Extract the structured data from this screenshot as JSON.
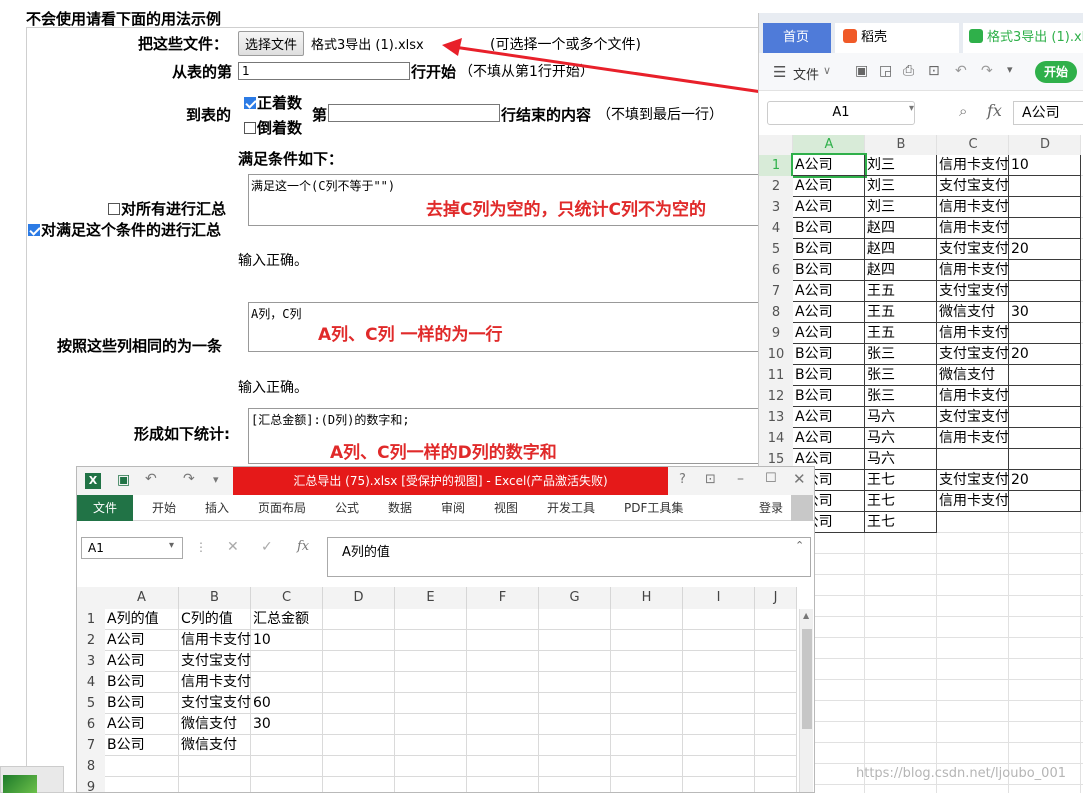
{
  "page": {
    "heading": "不会使用请看下面的用法示例",
    "file_label": "把这些文件：",
    "file_button": "选择文件",
    "file_name": "格式3导出 (1).xlsx",
    "file_hint": "(可选择一个或多个文件)",
    "from_row_label": "从表的第",
    "from_row_value": "1",
    "from_row_suffix": "行开始",
    "from_row_hint": "（不填从第1行开始）",
    "to_label": "到表的",
    "forward_label": "正着数",
    "reverse_label": "倒着数",
    "di_label": "第",
    "end_suffix": "行结束的内容",
    "end_hint": "（不填到最后一行）",
    "cond_label": "满足条件如下：",
    "sum_all_label": "对所有进行汇总",
    "sum_cond_label": "对满足这个条件的进行汇总",
    "cond_text": "满足这一个(C列不等于\"\")",
    "cond_annot": "去掉C列为空的，只统计C列不为空的",
    "input_ok_1": "输入正确。",
    "group_label": "按照这些列相同的为一条",
    "group_text": "A列，C列",
    "group_annot": "A列、C列  一样的为一行",
    "input_ok_2": "输入正确。",
    "stat_label": "形成如下统计:",
    "stat_text": "[汇总金额]:(D列)的数字和;",
    "stat_annot": "A列、C列一样的D列的数字和"
  },
  "wps": {
    "tabs": [
      "首页",
      "稻壳",
      "格式3导出 (1).xls"
    ],
    "menu_file": "文件",
    "start_button": "开始",
    "cell_ref": "A1",
    "fx_label": "fx",
    "formula_value": "A公司",
    "columns": [
      "A",
      "B",
      "C",
      "D"
    ],
    "rows": [
      {
        "n": "1",
        "a": "A公司",
        "b": "刘三",
        "c": "信用卡支付",
        "d": "10"
      },
      {
        "n": "2",
        "a": "A公司",
        "b": "刘三",
        "c": "支付宝支付",
        "d": ""
      },
      {
        "n": "3",
        "a": "A公司",
        "b": "刘三",
        "c": "信用卡支付",
        "d": ""
      },
      {
        "n": "4",
        "a": "B公司",
        "b": "赵四",
        "c": "信用卡支付",
        "d": ""
      },
      {
        "n": "5",
        "a": "B公司",
        "b": "赵四",
        "c": "支付宝支付",
        "d": "20"
      },
      {
        "n": "6",
        "a": "B公司",
        "b": "赵四",
        "c": "信用卡支付",
        "d": ""
      },
      {
        "n": "7",
        "a": "A公司",
        "b": "王五",
        "c": "支付宝支付",
        "d": ""
      },
      {
        "n": "8",
        "a": "A公司",
        "b": "王五",
        "c": "微信支付",
        "d": "30"
      },
      {
        "n": "9",
        "a": "A公司",
        "b": "王五",
        "c": "信用卡支付",
        "d": ""
      },
      {
        "n": "10",
        "a": "B公司",
        "b": "张三",
        "c": "支付宝支付",
        "d": "20"
      },
      {
        "n": "11",
        "a": "B公司",
        "b": "张三",
        "c": "微信支付",
        "d": ""
      },
      {
        "n": "12",
        "a": "B公司",
        "b": "张三",
        "c": "信用卡支付",
        "d": ""
      },
      {
        "n": "13",
        "a": "A公司",
        "b": "马六",
        "c": "支付宝支付",
        "d": ""
      },
      {
        "n": "14",
        "a": "A公司",
        "b": "马六",
        "c": "信用卡支付",
        "d": ""
      },
      {
        "n": "15",
        "a": "A公司",
        "b": "马六",
        "c": "",
        "d": ""
      },
      {
        "n": "16",
        "a": "B公司",
        "b": "王七",
        "c": "支付宝支付",
        "d": "20"
      },
      {
        "n": "17",
        "a": "B公司",
        "b": "王七",
        "c": "信用卡支付",
        "d": ""
      },
      {
        "n": "18",
        "a": "B公司",
        "b": "王七",
        "c": "",
        "d": ""
      }
    ]
  },
  "excel": {
    "title": "汇总导出 (75).xlsx  [受保护的视图] -  Excel(产品激活失败)",
    "ribbon_tabs": [
      "文件",
      "开始",
      "插入",
      "页面布局",
      "公式",
      "数据",
      "审阅",
      "视图",
      "开发工具",
      "PDF工具集"
    ],
    "login": "登录",
    "cell_ref": "A1",
    "fx_label": "fx",
    "formula_value": "A列的值",
    "columns": [
      "A",
      "B",
      "C",
      "D",
      "E",
      "F",
      "G",
      "H",
      "I",
      "J"
    ],
    "rows": [
      {
        "n": "1",
        "a": "A列的值",
        "b": "C列的值",
        "c": "汇总金额"
      },
      {
        "n": "2",
        "a": "A公司",
        "b": "信用卡支付",
        "c": "10"
      },
      {
        "n": "3",
        "a": "A公司",
        "b": "支付宝支付",
        "c": ""
      },
      {
        "n": "4",
        "a": "B公司",
        "b": "信用卡支付",
        "c": ""
      },
      {
        "n": "5",
        "a": "B公司",
        "b": "支付宝支付",
        "c": "60"
      },
      {
        "n": "6",
        "a": "A公司",
        "b": "微信支付",
        "c": "30"
      },
      {
        "n": "7",
        "a": "B公司",
        "b": "微信支付",
        "c": ""
      },
      {
        "n": "8",
        "a": "",
        "b": "",
        "c": ""
      },
      {
        "n": "9",
        "a": "",
        "b": "",
        "c": ""
      }
    ]
  },
  "watermark": "https://blog.csdn.net/ljoubo_001",
  "colors": {
    "annotation_red": "#e02a2a",
    "excel_red": "#e51919",
    "wps_green": "#2fb04a",
    "excel_green": "#217346"
  }
}
